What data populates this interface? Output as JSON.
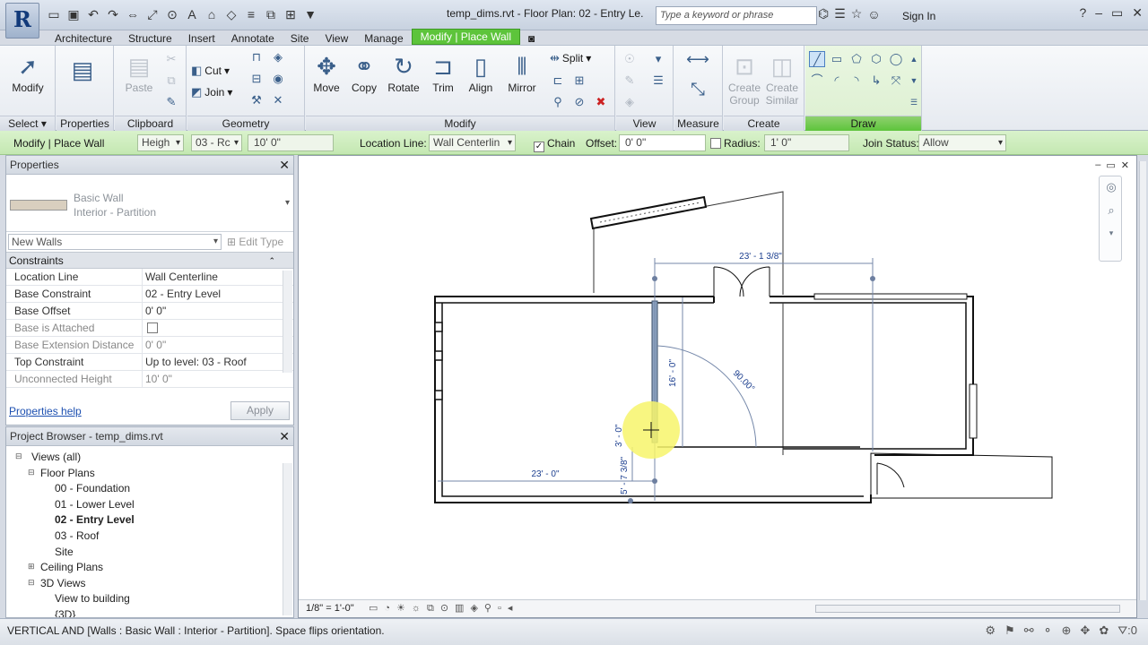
{
  "app": {
    "logo": "R",
    "document_title": "temp_dims.rvt - Floor Plan: 02 - Entry Le...",
    "search_placeholder": "Type a keyword or phrase",
    "sign_in": "Sign In"
  },
  "qat_icons": [
    "open-icon",
    "save-icon",
    "undo-icon",
    "redo-icon",
    "measure-icon",
    "dimension-icon",
    "tag-icon",
    "text-icon",
    "3d-view-icon",
    "section-icon",
    "thin-lines-icon",
    "close-hidden-icon",
    "switch-windows-icon",
    "view-cube-icon"
  ],
  "tabs": [
    "Architecture",
    "Structure",
    "Insert",
    "Annotate",
    "Site",
    "View",
    "Manage",
    "Modify | Place Wall"
  ],
  "active_tab": "Modify | Place Wall",
  "ribbon": {
    "select": {
      "modify": "Modify",
      "label": "Select"
    },
    "properties": {
      "btn": "Properties",
      "label": "Properties"
    },
    "clipboard": {
      "paste": "Paste",
      "label": "Clipboard"
    },
    "geometry": {
      "cut": "Cut",
      "join": "Join",
      "label": "Geometry"
    },
    "modify": {
      "move": "Move",
      "copy": "Copy",
      "rotate": "Rotate",
      "trim": "Trim",
      "align": "Align",
      "mirror": "Mirror",
      "split": "Split",
      "label": "Modify"
    },
    "view": {
      "label": "View"
    },
    "measure": {
      "label": "Measure"
    },
    "create": {
      "group": "Create Group",
      "similar": "Create Similar",
      "label": "Create"
    },
    "draw": {
      "label": "Draw"
    }
  },
  "optbar": {
    "context": "Modify | Place Wall",
    "height_mode": "Heigh",
    "level": "03 - Rc",
    "height_value": "10'  0\"",
    "location_line_label": "Location Line:",
    "location_line_value": "Wall Centerlin",
    "chain_label": "Chain",
    "chain_checked": "✓",
    "offset_label": "Offset:",
    "offset_value": "0'  0\"",
    "radius_label": "Radius:",
    "radius_value": "1'  0\"",
    "join_status_label": "Join Status:",
    "join_status_value": "Allow"
  },
  "properties": {
    "title": "Properties",
    "family": "Basic Wall",
    "type": "Interior - Partition",
    "instance_filter": "New Walls",
    "edit_type": "Edit Type",
    "group": "Constraints",
    "rows": [
      {
        "k": "Location Line",
        "v": "Wall Centerline"
      },
      {
        "k": "Base Constraint",
        "v": "02 - Entry Level"
      },
      {
        "k": "Base Offset",
        "v": "0'  0\""
      },
      {
        "k": "Base is Attached",
        "v": ""
      },
      {
        "k": "Base Extension Distance",
        "v": "0'  0\""
      },
      {
        "k": "Top Constraint",
        "v": "Up to level: 03 - Roof"
      },
      {
        "k": "Unconnected Height",
        "v": "10'  0\""
      }
    ],
    "help": "Properties help",
    "apply": "Apply"
  },
  "browser": {
    "title": "Project Browser - temp_dims.rvt",
    "items": [
      {
        "label": "Views (all)"
      },
      {
        "label": "Floor Plans"
      },
      {
        "label": "00 - Foundation"
      },
      {
        "label": "01 - Lower Level"
      },
      {
        "label": "02 - Entry Level"
      },
      {
        "label": "03 - Roof"
      },
      {
        "label": "Site"
      },
      {
        "label": "Ceiling Plans"
      },
      {
        "label": "3D Views"
      },
      {
        "label": "View to building"
      },
      {
        "label": "{3D}"
      }
    ]
  },
  "canvas": {
    "dim_top": "23' - 1 3/8\"",
    "dim_angle": "90.00°",
    "dim_vertical": "16' - 0\"",
    "dim_short": "3' - 0\"",
    "dim_lower": "5' - 7 3/8\"",
    "dim_bottom": "23' - 0\"",
    "scale": "1/8\" = 1'-0\""
  },
  "status": {
    "text": "VERTICAL AND [Walls : Basic Wall : Interior - Partition].  Space flips orientation.",
    "filter_count": ":0"
  }
}
